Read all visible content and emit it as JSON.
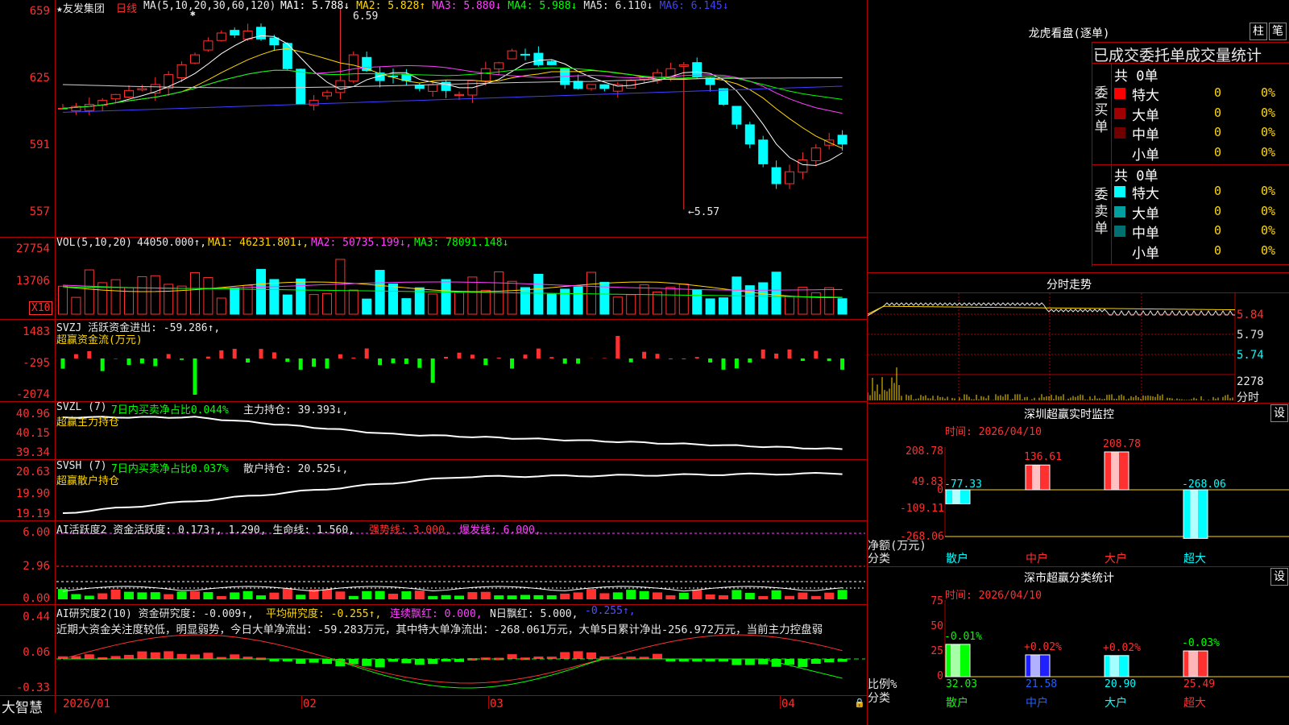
{
  "stock": {
    "name": "★友发集团",
    "period": "日线",
    "ma_header": "MA(5,10,20,30,60,120)",
    "ma": [
      {
        "label": "MA1: 5.788↓",
        "color": "#ffffff"
      },
      {
        "label": "MA2: 5.828↑",
        "color": "#ffd800"
      },
      {
        "label": "MA3: 5.880↓",
        "color": "#ff40ff"
      },
      {
        "label": "MA4: 5.988↓",
        "color": "#00ff00"
      },
      {
        "label": "MA5: 6.110↓",
        "color": "#e0e0e0"
      },
      {
        "label": "MA6: 6.145↓",
        "color": "#4040ff"
      }
    ],
    "price_axis": [
      "659",
      "625",
      "591",
      "557"
    ],
    "high_label": "6.59",
    "low_label": "←5.57"
  },
  "vol": {
    "header": "VOL(5,10,20)",
    "value": "44050.000↑,",
    "ma1": "MA1: 46231.801↓,",
    "ma2": "MA2: 50735.199↓,",
    "ma3": "MA3: 78091.148↓",
    "axis": [
      "27754",
      "13706"
    ],
    "unit": "X10"
  },
  "svzj": {
    "header": "SVZJ  活跃资金进出: -59.286↑,",
    "subtitle": "超赢资金流(万元)",
    "axis": [
      "1483",
      "-295",
      "-2074"
    ]
  },
  "svzl": {
    "header": "SVZL (7)",
    "ratio": "7日内买卖净占比0.044%",
    "holding": "主力持仓: 39.393↓,",
    "subtitle": "超赢主力持仓",
    "axis": [
      "40.96",
      "40.15",
      "39.34"
    ]
  },
  "svsh": {
    "header": "SVSH (7)",
    "ratio": "7日内买卖净占比0.037%",
    "holding": "散户持仓: 20.525↓,",
    "subtitle": "超赢散户持仓",
    "axis": [
      "20.63",
      "19.90",
      "19.19"
    ]
  },
  "ai_active": {
    "header": "AI活跃度2 资金活跃度: 0.173↑, 1.290, 生命线: 1.560,",
    "strong": "强势线: 3.000,",
    "burst": "爆发线: 6.000,",
    "axis": [
      "6.00",
      "2.96",
      "0.00"
    ]
  },
  "ai_research": {
    "header": "AI研究度2(10) 资金研究度: -0.009↑,",
    "avg": "平均研究度: -0.255↑,",
    "streak": "连续飘红: 0.000,",
    "nday": "N日飘红: 5.000,",
    "last": "-0.255↑,",
    "comment": "近期大资金关注度较低，明显弱势，今日大单净流出：-59.283万元，其中特大单净流出：-268.061万元，大单5日累计净出-256.972万元，当前主力控盘弱",
    "axis": [
      "0.44",
      "0.06",
      "-0.33"
    ]
  },
  "xaxis": {
    "logo": "大智慧",
    "labels": [
      "2026/01",
      "02",
      "03",
      "04"
    ]
  },
  "right": {
    "dragon_title": "龙虎看盘(逐单)",
    "btn1": "柱",
    "btn2": "笔",
    "stat_title": "已成交委托单成交量统计",
    "buy_label": "委买单",
    "sell_label": "委卖单",
    "buy_total": "共 0单",
    "sell_total": "共 0单",
    "buy_rows": [
      {
        "name": "特大",
        "qty": "0",
        "pct": "0%",
        "color": "#ff0000"
      },
      {
        "name": "大单",
        "qty": "0",
        "pct": "0%",
        "color": "#a00000"
      },
      {
        "name": "中单",
        "qty": "0",
        "pct": "0%",
        "color": "#700000"
      },
      {
        "name": "小单",
        "qty": "0",
        "pct": "0%",
        "color": "#000000"
      }
    ],
    "sell_rows": [
      {
        "name": "特大",
        "qty": "0",
        "pct": "0%",
        "color": "#00ffff"
      },
      {
        "name": "大单",
        "qty": "0",
        "pct": "0%",
        "color": "#00a0a0"
      },
      {
        "name": "中单",
        "qty": "0",
        "pct": "0%",
        "color": "#007070"
      },
      {
        "name": "小单",
        "qty": "0",
        "pct": "0%",
        "color": "#000000"
      }
    ],
    "intraday_title": "分时走势",
    "intraday_axis": [
      "5.84",
      "5.79",
      "5.74"
    ],
    "intraday_vol": "2278",
    "intraday_vol_unit": "分时",
    "sz_monitor_title": "深圳超赢实时监控",
    "sz_monitor_time": "时间: 2026/04/10",
    "set_label": "设",
    "monitor_axis": [
      "208.78",
      "49.83",
      "0",
      "-109.11",
      "-268.06"
    ],
    "monitor_ylabel": "净额(万元)",
    "monitor_xlabel": "分类",
    "monitor_bars": [
      {
        "cat": "散户",
        "val": "-77.33",
        "color": "#00ffff"
      },
      {
        "cat": "中户",
        "val": "136.61",
        "color": "#ff3030"
      },
      {
        "cat": "大户",
        "val": "208.78",
        "color": "#ff3030"
      },
      {
        "cat": "超大",
        "val": "-268.06",
        "color": "#00ffff"
      }
    ],
    "stat2_title": "深市超赢分类统计",
    "stat2_time": "时间: 2026/04/10",
    "stat2_axis": [
      "75",
      "50",
      "25",
      "0"
    ],
    "stat2_ylabel": "比例%",
    "stat2_xlabel": "分类",
    "stat2_bars": [
      {
        "cat": "散户",
        "val": "32.03",
        "chg": "-0.01%",
        "chgcolor": "#00ff00",
        "color": "#00ff00"
      },
      {
        "cat": "中户",
        "val": "21.58",
        "chg": "+0.02%",
        "chgcolor": "#ff3030",
        "color": "#2020ff"
      },
      {
        "cat": "大户",
        "val": "20.90",
        "chg": "+0.02%",
        "chgcolor": "#ff3030",
        "color": "#00ffff"
      },
      {
        "cat": "超大",
        "val": "25.49",
        "chg": "-0.03%",
        "chgcolor": "#00ff00",
        "color": "#ff3030"
      }
    ]
  }
}
